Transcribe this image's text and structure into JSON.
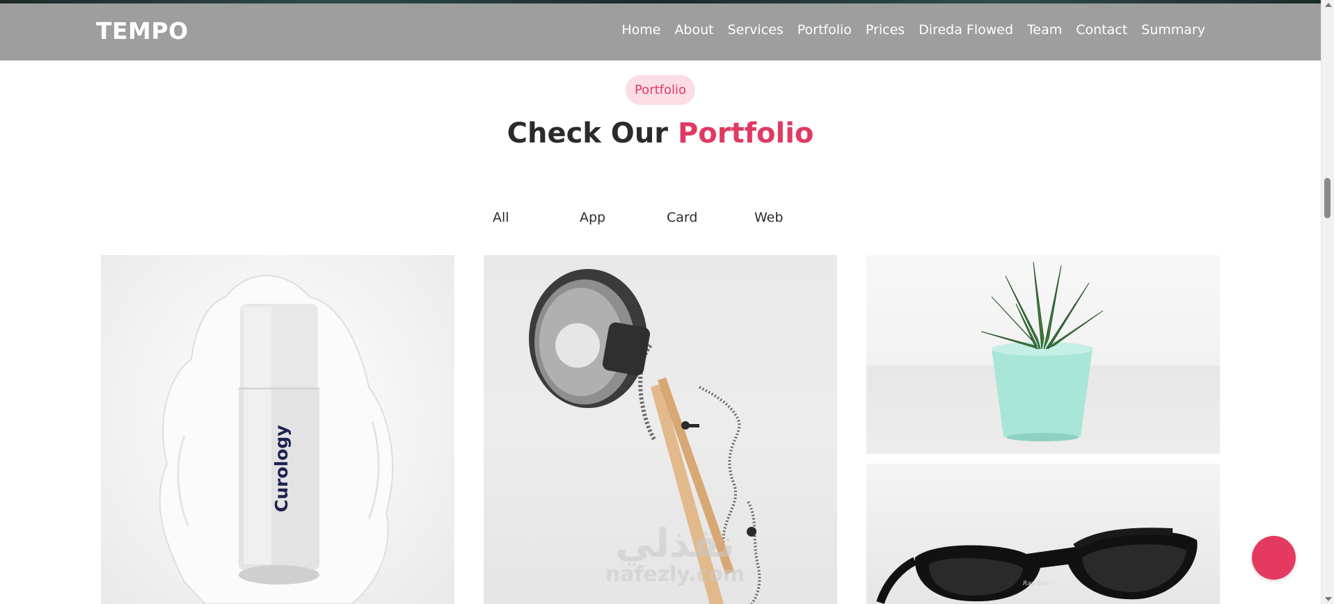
{
  "brand": "TEMPO",
  "nav": {
    "items": [
      "Home",
      "About",
      "Services",
      "Portfolio",
      "Prices",
      "Direda Flowed",
      "Team",
      "Contact",
      "Summary"
    ]
  },
  "section": {
    "badge": "Portfolio",
    "heading_plain": "Check Our ",
    "heading_accent": "Portfolio"
  },
  "filters": [
    "All",
    "App",
    "Card",
    "Web"
  ],
  "gallery": {
    "bottle_label": "Curology",
    "sunglasses_brand": "Ray-Ban",
    "watermark_arabic": "نفذلي",
    "watermark_latin": "nafezly.com"
  },
  "colors": {
    "accent": "#e03a63",
    "badge_bg": "#fcdde5",
    "navbar_bg": "#9e9e9e",
    "fab": "#e53a5f"
  }
}
